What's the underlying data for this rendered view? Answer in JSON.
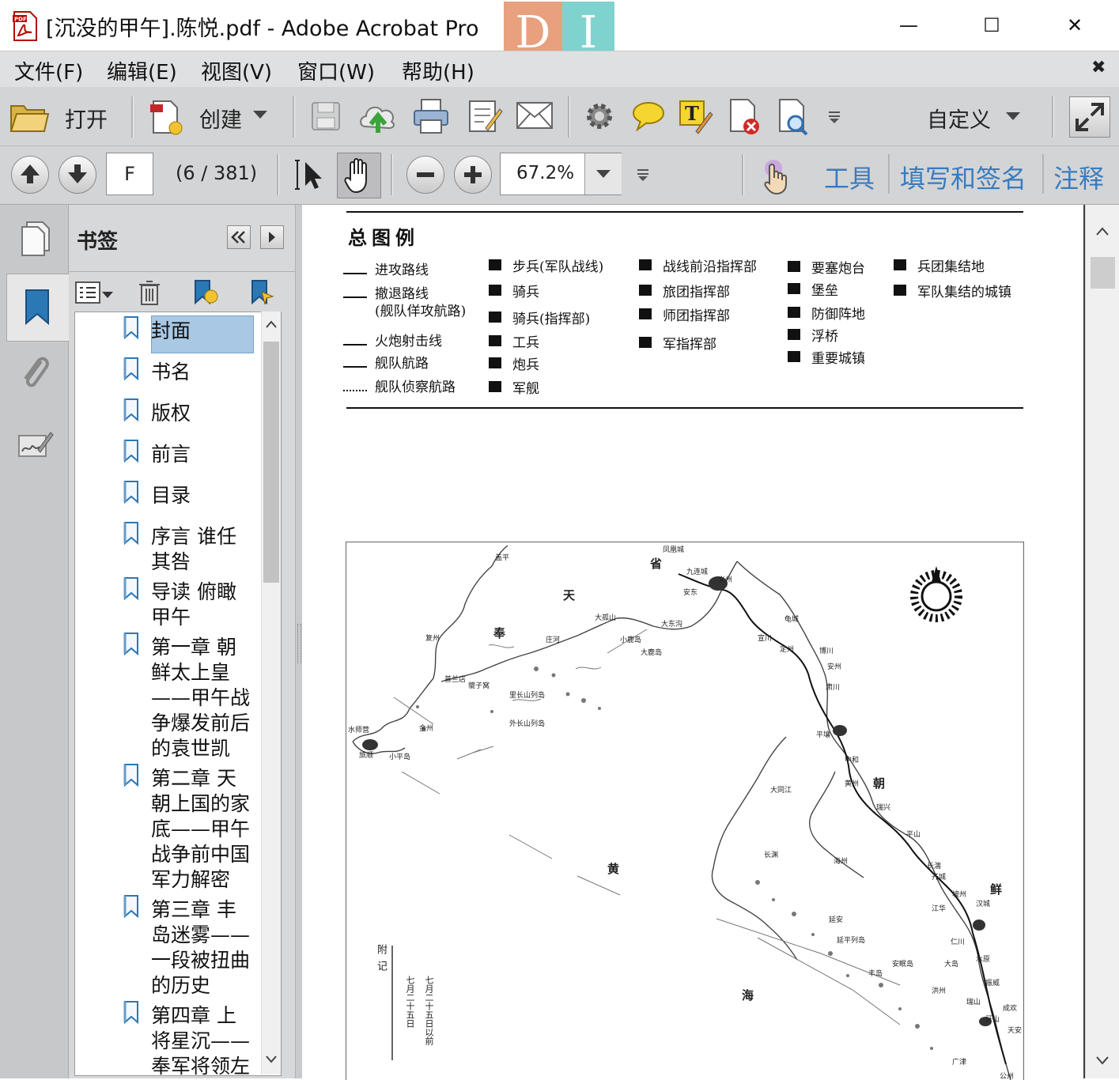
{
  "window": {
    "title": "[沉没的甲午].陈悦.pdf - Adobe Acrobat Pro",
    "logo_letters": [
      "D",
      "I"
    ],
    "controls": {
      "minimize": "—",
      "maximize": "☐",
      "close": "✕"
    }
  },
  "menu": {
    "items": [
      "文件(F)",
      "编辑(E)",
      "视图(V)",
      "窗口(W)",
      "帮助(H)"
    ],
    "close_glyph": "✖"
  },
  "toolbar": {
    "open_label": "打开",
    "create_label": "创建",
    "customize_label": "自定义"
  },
  "nav_toolbar": {
    "page_value": "F",
    "page_count": "(6 / 381)",
    "zoom_value": "67.2%",
    "tabs": [
      "工具",
      "填写和签名",
      "注释"
    ]
  },
  "bookmarks": {
    "title": "书签",
    "items": [
      "封面",
      "书名",
      "版权",
      "前言",
      "目录",
      "序言 谁任其咎",
      "导读 俯瞰甲午",
      "第一章 朝鲜太上皇——甲午战争爆发前后的袁世凯",
      "第二章 天朝上国的家底——甲午战争前中国军力解密",
      "第三章 丰岛迷雾——一段被扭曲的历史",
      "第四章 上将星沉——奉军将领左"
    ],
    "selected": "封面"
  },
  "legend": {
    "title": "总图例",
    "col1": [
      "进攻路线",
      "撤退路线",
      "(舰队佯攻航路)",
      "火炮射击线",
      "舰队航路",
      "舰队侦察航路"
    ],
    "col2": [
      "步兵(军队战线)",
      "骑兵",
      "骑兵(指挥部)",
      "工兵",
      "炮兵",
      "军舰"
    ],
    "col3": [
      "战线前沿指挥部",
      "旅团指挥部",
      "师团指挥部",
      "军指挥部"
    ],
    "col4": [
      "要塞炮台",
      "堡垒",
      "防御阵地",
      "浮桥",
      "重要城镇"
    ],
    "col5": [
      "兵团集结地",
      "军队集结的城镇"
    ]
  },
  "map": {
    "large_labels": [
      "省",
      "天",
      "奉",
      "朝",
      "黄",
      "鲜",
      "海"
    ],
    "place_labels": [
      "凤凰城",
      "九连城",
      "义州",
      "安东",
      "大孤山",
      "大东沟",
      "庄河",
      "小鹿岛",
      "大鹿岛",
      "盖平",
      "复州",
      "普兰店",
      "貔子窝",
      "里长山列岛",
      "外长山列岛",
      "金州",
      "旅顺",
      "小平岛",
      "水师营",
      "龟城",
      "宣川",
      "定州",
      "博川",
      "安州",
      "肃川",
      "平壤",
      "中和",
      "黄州",
      "瑞兴",
      "大同江",
      "长渊",
      "海州",
      "平山",
      "开城",
      "长湍",
      "汉城",
      "坡州",
      "江华",
      "延安",
      "延平列岛",
      "仁川",
      "水原",
      "振威",
      "成欢",
      "天安",
      "牙山",
      "广津",
      "公州",
      "大岛",
      "丰岛",
      "安眠岛",
      "洪州",
      "瑞山"
    ],
    "note_heading": "附记",
    "note_lines": [
      "七月二十五日以前",
      "七月二十五日"
    ]
  }
}
